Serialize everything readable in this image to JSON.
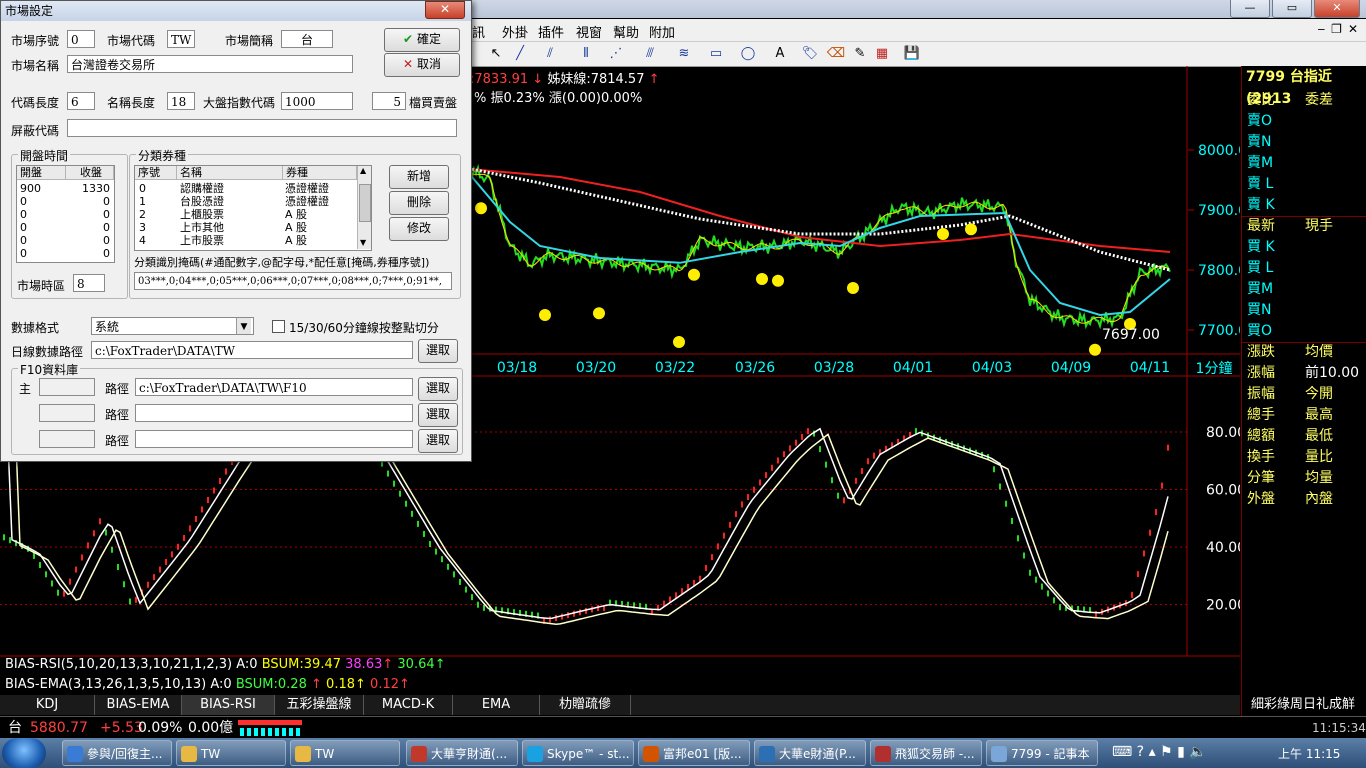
{
  "window_controls": {
    "minimize": "—",
    "restore": "▭",
    "close": "✕"
  },
  "menu": [
    "訊",
    "外掛",
    "插件",
    "視窗",
    "幫助",
    "附加"
  ],
  "info": {
    "price_label": ":7833.91",
    "price_arrow": "↓",
    "sister_label": "姊妹線:7814.57",
    "sister_arrow": "↑",
    "line2": "% 振0.23% 漲(0.00)0.00%"
  },
  "right_header": "7799 台指近(2913",
  "right_panel": [
    {
      "a": "委比",
      "b": "委差",
      "a_color": "#ffff66",
      "b_color": "#ffff66"
    },
    {
      "a": "賣O",
      "b": "",
      "a_color": "#00ffff",
      "b_color": "#fff"
    },
    {
      "a": "賣N",
      "b": "",
      "a_color": "#00ffff",
      "b_color": "#fff"
    },
    {
      "a": "賣M",
      "b": "",
      "a_color": "#00ffff",
      "b_color": "#fff"
    },
    {
      "a": "賣 L",
      "b": "",
      "a_color": "#00ffff",
      "b_color": "#fff"
    },
    {
      "a": "賣 K",
      "b": "",
      "a_color": "#00ffff",
      "b_color": "#fff"
    },
    {
      "a": "最新",
      "b": "現手",
      "a_color": "#ffff66",
      "b_color": "#ffff66"
    },
    {
      "a": "買 K",
      "b": "",
      "a_color": "#00ffff",
      "b_color": "#fff"
    },
    {
      "a": "買 L",
      "b": "",
      "a_color": "#00ffff",
      "b_color": "#fff"
    },
    {
      "a": "買M",
      "b": "",
      "a_color": "#00ffff",
      "b_color": "#fff"
    },
    {
      "a": "買N",
      "b": "",
      "a_color": "#00ffff",
      "b_color": "#fff"
    },
    {
      "a": "買O",
      "b": "",
      "a_color": "#00ffff",
      "b_color": "#fff"
    },
    {
      "a": "漲跌",
      "b": "均價",
      "a_color": "#ffff66",
      "b_color": "#ffff66"
    },
    {
      "a": "漲幅",
      "b": "前10.00",
      "a_color": "#ffff66",
      "b_color": "#ffffff"
    },
    {
      "a": "振幅",
      "b": "今開",
      "a_color": "#ffff66",
      "b_color": "#ffff66"
    },
    {
      "a": "總手",
      "b": "最高",
      "a_color": "#ffff66",
      "b_color": "#ffff66"
    },
    {
      "a": "總額",
      "b": "最低",
      "a_color": "#ffff66",
      "b_color": "#ffff66"
    },
    {
      "a": "換手",
      "b": "量比",
      "a_color": "#ffff66",
      "b_color": "#ffff66"
    },
    {
      "a": "分筆",
      "b": "均量",
      "a_color": "#ffff66",
      "b_color": "#ffff66"
    },
    {
      "a": "外盤",
      "b": "內盤",
      "a_color": "#ffff66",
      "b_color": "#ffff66"
    }
  ],
  "price_axis": [
    "8000.0",
    "7900.0",
    "7800.0",
    "7700.0"
  ],
  "price_axis_values": [
    8000,
    7900,
    7800,
    7700
  ],
  "low_label": "7697.00",
  "dates": [
    "03/18",
    "03/20",
    "03/22",
    "03/26",
    "03/28",
    "04/01",
    "04/03",
    "04/09",
    "04/11"
  ],
  "period": "1分鐘",
  "osc_axis": [
    "80.00",
    "60.00",
    "40.00",
    "20.00"
  ],
  "osc_axis_values": [
    80,
    60,
    40,
    20
  ],
  "ind1": {
    "name": "BIAS-RSI(5,10,20,13,3,10,21,1,2,3)",
    "a": "A:0",
    "bsum_label": "BSUM:",
    "v1": "39.47",
    "v2": "38.63",
    "a1": "↑",
    "v3": "30.64",
    "a2": "↑"
  },
  "ind2": {
    "name": "BIAS-EMA(3,13,26,1,3,5,10,13)",
    "a": "A:0",
    "bsum_label": "BSUM:",
    "v1": "0.28",
    "a1": "↑",
    "v2": "0.18",
    "a2": "↑",
    "v3": "0.12",
    "a3": "↑"
  },
  "tabs": [
    "KDJ",
    "BIAS-EMA",
    "BIAS-RSI",
    "五彩操盤線",
    "MACD-K",
    "EMA",
    "朸贈疏傪"
  ],
  "tabs_right": "細彩綠周日礼成觧",
  "ticker": {
    "name": "台",
    "price": "5880.77",
    "change": "+5.53",
    "pct": "0.09%",
    "amount": "0.00億",
    "time": "11:15:34"
  },
  "taskbar": {
    "items": [
      {
        "label": "參與/回復主...",
        "color": "#3a7bd5"
      },
      {
        "label": "TW",
        "color": "#e7b944"
      },
      {
        "label": "TW",
        "color": "#e7b944"
      },
      {
        "label": "大華亨財通(...",
        "color": "#c0392b"
      },
      {
        "label": "Skype™ - st...",
        "color": "#1aa1e1"
      },
      {
        "label": "富邦e01 [版...",
        "color": "#d35400"
      },
      {
        "label": "大華e財通(P...",
        "color": "#2c6fb3"
      },
      {
        "label": "飛狐交易師 -...",
        "color": "#b03030"
      },
      {
        "label": "7799 - 記事本",
        "color": "#7aa7d8"
      }
    ],
    "clock": "上午 11:15"
  },
  "dialog": {
    "title": "市場設定",
    "close": "✕",
    "seq_label": "市場序號",
    "seq_value": "0",
    "code_label": "市場代碼",
    "code_value": "TW",
    "abbr_label": "市場簡稱",
    "abbr_value": "台",
    "name_label": "市場名稱",
    "name_value": "台灣證卷交易所",
    "ok_label": "確定",
    "cancel_label": "取消",
    "codelen_label": "代碼長度",
    "codelen_value": "6",
    "namelen_label": "名稱長度",
    "namelen_value": "18",
    "index_label": "大盤指數代碼",
    "index_value": "1000",
    "depth_value": "5",
    "depth_label": "檔買賣盤",
    "mask_label": "屏蔽代碼",
    "mask_value": "",
    "hours_group": "開盤時間",
    "hours_headers": [
      "開盤",
      "收盤"
    ],
    "hours_rows": [
      [
        "900",
        "1330"
      ],
      [
        "0",
        "0"
      ],
      [
        "0",
        "0"
      ],
      [
        "0",
        "0"
      ],
      [
        "0",
        "0"
      ],
      [
        "0",
        "0"
      ]
    ],
    "tz_label": "市場時區",
    "tz_value": "8",
    "cat_group": "分類券種",
    "cat_headers": [
      "序號",
      "名稱",
      "券種"
    ],
    "cat_rows": [
      [
        "0",
        "認購權證",
        "憑證權證"
      ],
      [
        "1",
        "台股憑證",
        "憑證權證"
      ],
      [
        "2",
        "上櫃股票",
        "A 股"
      ],
      [
        "3",
        "上市其他",
        "A 股"
      ],
      [
        "4",
        "上市股票",
        "A 股"
      ]
    ],
    "add_label": "新增",
    "del_label": "刪除",
    "edit_label": "修改",
    "mask_desc": "分類識別掩碼(#通配數字,@配字母,*配任意[掩碼,券種序號])",
    "mask_codes": "03***,0;04***,0;05***,0;06***,0;07***,0;08***,0;7***,0;91**,",
    "format_label": "數據格式",
    "format_value": "系統",
    "split_label": "15/30/60分鐘線按整點切分",
    "path_label": "日線數據路徑",
    "path_value": "c:\\FoxTrader\\DATA\\TW",
    "browse": "選取",
    "f10_group": "F10資料庫",
    "f10_rows": [
      {
        "head": "主",
        "label": "路徑",
        "value": "c:\\FoxTrader\\DATA\\TW\\F10"
      },
      {
        "head": "",
        "label": "路徑",
        "value": ""
      },
      {
        "head": "",
        "label": "路徑",
        "value": ""
      }
    ]
  }
}
